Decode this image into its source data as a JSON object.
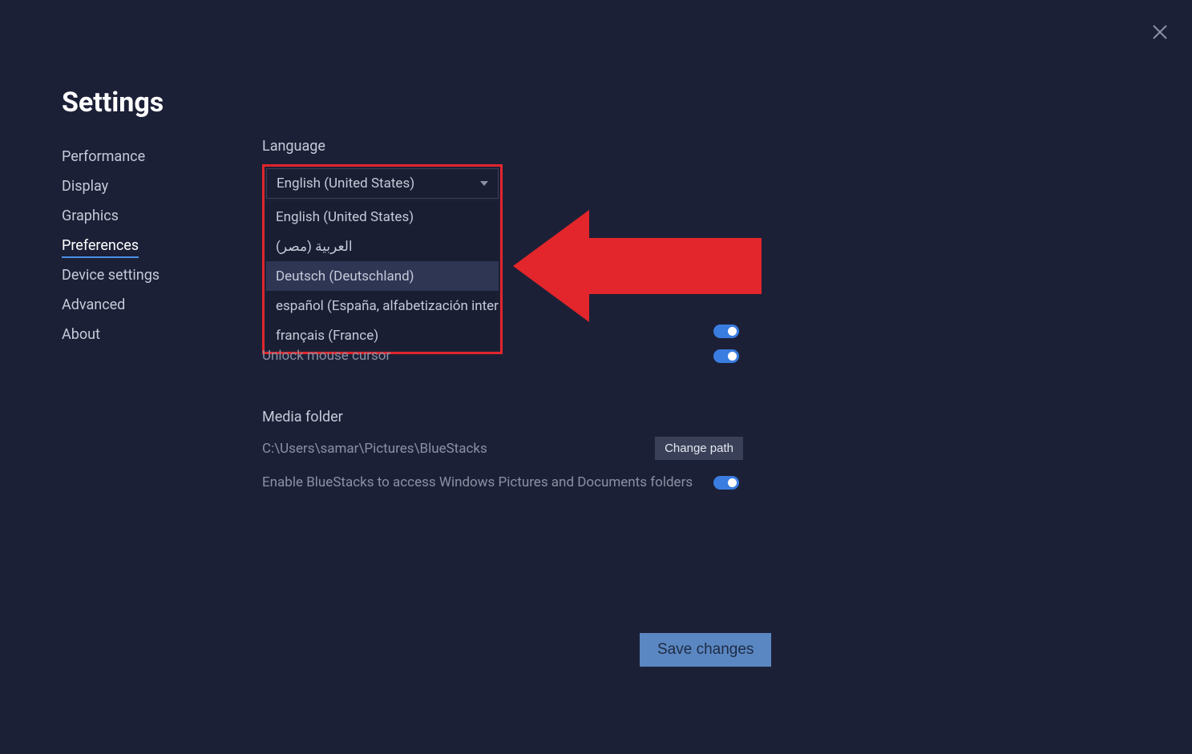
{
  "title": "Settings",
  "sidebar": {
    "items": [
      {
        "label": "Performance",
        "active": false
      },
      {
        "label": "Display",
        "active": false
      },
      {
        "label": "Graphics",
        "active": false
      },
      {
        "label": "Preferences",
        "active": true
      },
      {
        "label": "Device settings",
        "active": false
      },
      {
        "label": "Advanced",
        "active": false
      },
      {
        "label": "About",
        "active": false
      }
    ]
  },
  "language": {
    "label": "Language",
    "selected": "English (United States)",
    "options": [
      "English (United States)",
      "العربية (مصر)",
      "Deutsch (Deutschland)",
      "español (España, alfabetización inter…",
      "français (France)"
    ],
    "hovered_index": 2
  },
  "toggles": {
    "unlock_mouse": {
      "label": "Unlock mouse cursor",
      "on": true
    },
    "hidden_toggle": {
      "on": true
    }
  },
  "media": {
    "section_label": "Media folder",
    "path": "C:\\Users\\samar\\Pictures\\BlueStacks",
    "change_path_label": "Change path",
    "access_label": "Enable BlueStacks to access Windows Pictures and Documents folders",
    "access_on": true
  },
  "save_button_label": "Save changes"
}
